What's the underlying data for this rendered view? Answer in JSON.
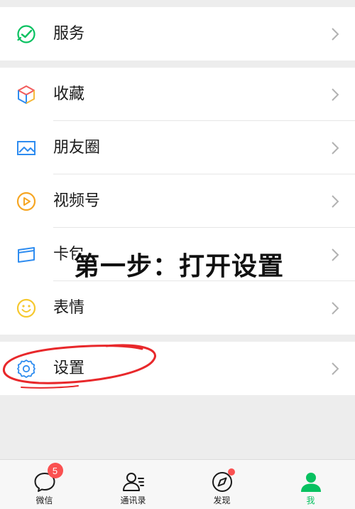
{
  "groups": [
    {
      "items": [
        {
          "label": "服务",
          "icon": "service-icon"
        }
      ]
    },
    {
      "items": [
        {
          "label": "收藏",
          "icon": "favorites-cube-icon"
        },
        {
          "label": "朋友圈",
          "icon": "moments-image-icon"
        },
        {
          "label": "视频号",
          "icon": "channels-play-icon"
        },
        {
          "label": "卡包",
          "icon": "card-wallet-icon"
        },
        {
          "label": "表情",
          "icon": "sticker-smile-icon"
        }
      ]
    },
    {
      "items": [
        {
          "label": "设置",
          "icon": "settings-gear-icon"
        }
      ]
    }
  ],
  "overlay": {
    "caption": "第一步：打开设置"
  },
  "tabbar": {
    "tabs": [
      {
        "label": "微信",
        "icon": "chat-bubble-icon",
        "badge": "5"
      },
      {
        "label": "通讯录",
        "icon": "contacts-icon"
      },
      {
        "label": "发现",
        "icon": "compass-icon"
      },
      {
        "label": "我",
        "icon": "me-person-icon"
      }
    ],
    "active_tab": "我"
  },
  "colors": {
    "accent_green": "#07c160",
    "badge_red": "#fa5151",
    "background": "#ededed"
  }
}
